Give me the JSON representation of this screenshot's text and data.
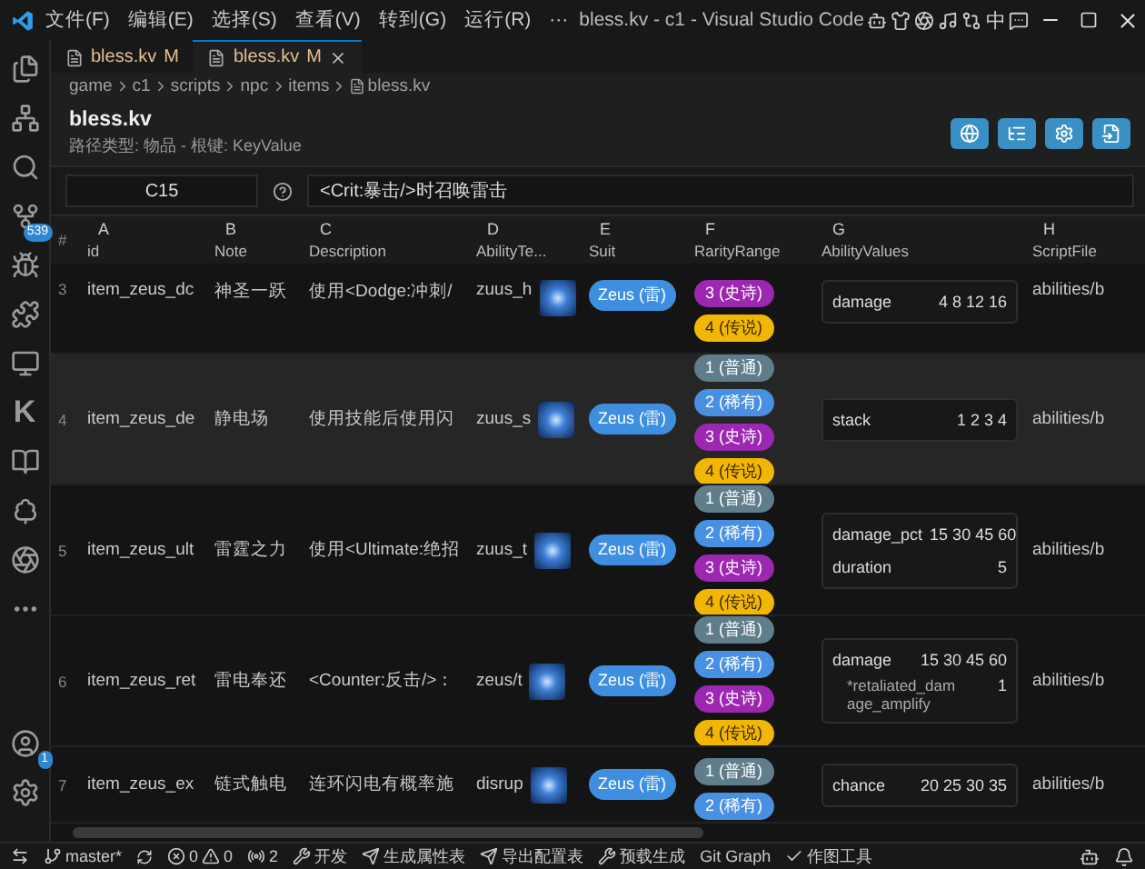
{
  "title_bar": {
    "menus": [
      "文件(F)",
      "编辑(E)",
      "选择(S)",
      "查看(V)",
      "转到(G)",
      "运行(R)"
    ],
    "more": "···",
    "title": "bless.kv - c1 - Visual Studio Code",
    "ime": "中"
  },
  "activity_bar": {
    "letter_item": "K",
    "source_control_badge": "539",
    "accounts_badge": "1"
  },
  "tabs": [
    {
      "label": "bless.kv",
      "status": "M",
      "selected": false
    },
    {
      "label": "bless.kv",
      "status": "M",
      "selected": true
    }
  ],
  "breadcrumbs": [
    "game",
    "c1",
    "scripts",
    "npc",
    "items",
    "bless.kv"
  ],
  "header": {
    "title": "bless.kv",
    "subtitle": "路径类型: 物品 - 根键: KeyValue"
  },
  "formula_bar": {
    "cell": "C15",
    "value": "<Crit:暴击/>时召唤雷击"
  },
  "table": {
    "index_header": "#",
    "columns": [
      {
        "letter": "A",
        "name": "id"
      },
      {
        "letter": "B",
        "name": "Note"
      },
      {
        "letter": "C",
        "name": "Description"
      },
      {
        "letter": "D",
        "name": "AbilityTe..."
      },
      {
        "letter": "E",
        "name": "Suit"
      },
      {
        "letter": "F",
        "name": "RarityRange"
      },
      {
        "letter": "G",
        "name": "AbilityValues"
      },
      {
        "letter": "H",
        "name": "ScriptFile"
      }
    ],
    "rows": [
      {
        "index": "3",
        "kind": "cut_top",
        "selected": false,
        "id": "item_zeus_dc",
        "note": "神圣一跃",
        "description": "使用<Dodge:冲刺/",
        "texture": "zuus_h",
        "suit": "Zeus (雷)",
        "rarity": [
          {
            "label": "3 (史诗)",
            "color": "#9c27b0"
          },
          {
            "label": "4 (传说)",
            "color": "#f2b705"
          }
        ],
        "ability_values": [
          {
            "name": "damage",
            "value": "4 8 12 16"
          }
        ],
        "script_file": "abilities/b"
      },
      {
        "index": "4",
        "kind": "full",
        "selected": true,
        "id": "item_zeus_de",
        "note": "静电场",
        "description": "使用技能后使用闪",
        "texture": "zuus_s",
        "suit": "Zeus (雷)",
        "rarity": [
          {
            "label": "1 (普通)",
            "color": "#607d8b"
          },
          {
            "label": "2 (稀有)",
            "color": "#4a90e2"
          },
          {
            "label": "3 (史诗)",
            "color": "#9c27b0"
          },
          {
            "label": "4 (传说)",
            "color": "#f2b705"
          }
        ],
        "ability_values": [
          {
            "name": "stack",
            "value": "1 2 3 4"
          }
        ],
        "script_file": "abilities/b"
      },
      {
        "index": "5",
        "kind": "full",
        "selected": false,
        "id": "item_zeus_ult",
        "note": "雷霆之力",
        "description": "使用<Ultimate:绝招",
        "texture": "zuus_t",
        "suit": "Zeus (雷)",
        "rarity": [
          {
            "label": "1 (普通)",
            "color": "#607d8b"
          },
          {
            "label": "2 (稀有)",
            "color": "#4a90e2"
          },
          {
            "label": "3 (史诗)",
            "color": "#9c27b0"
          },
          {
            "label": "4 (传说)",
            "color": "#f2b705"
          }
        ],
        "ability_values": [
          {
            "name": "damage_pct",
            "value": "15 30 45 60"
          },
          {
            "name": "duration",
            "value": "5"
          }
        ],
        "script_file": "abilities/b"
      },
      {
        "index": "6",
        "kind": "full",
        "selected": false,
        "id": "item_zeus_ret",
        "note": "雷电奉还",
        "description": "<Counter:反击/>：",
        "texture": "zeus/t",
        "suit": "Zeus (雷)",
        "rarity": [
          {
            "label": "1 (普通)",
            "color": "#607d8b"
          },
          {
            "label": "2 (稀有)",
            "color": "#4a90e2"
          },
          {
            "label": "3 (史诗)",
            "color": "#9c27b0"
          },
          {
            "label": "4 (传说)",
            "color": "#f2b705"
          }
        ],
        "ability_values": [
          {
            "name": "damage",
            "value": "15 30 45 60",
            "children": [
              {
                "name": "*retaliated_damage_amplify",
                "value": "1"
              }
            ]
          }
        ],
        "script_file": "abilities/b"
      },
      {
        "index": "7",
        "kind": "cut_bottom",
        "selected": false,
        "id": "item_zeus_ex",
        "note": "链式触电",
        "description": "连环闪电有概率施",
        "texture": "disrup",
        "suit": "Zeus (雷)",
        "rarity": [
          {
            "label": "1 (普通)",
            "color": "#607d8b"
          },
          {
            "label": "2 (稀有)",
            "color": "#4a90e2"
          }
        ],
        "ability_values": [
          {
            "name": "chance",
            "value": "20 25 30 35"
          }
        ],
        "script_file": "abilities/b"
      }
    ]
  },
  "status_bar": {
    "branch": "master*",
    "errors": "0",
    "warnings": "0",
    "ports": "2",
    "items": [
      "开发",
      "生成属性表",
      "导出配置表",
      "预载生成",
      "Git Graph",
      "作图工具"
    ]
  }
}
